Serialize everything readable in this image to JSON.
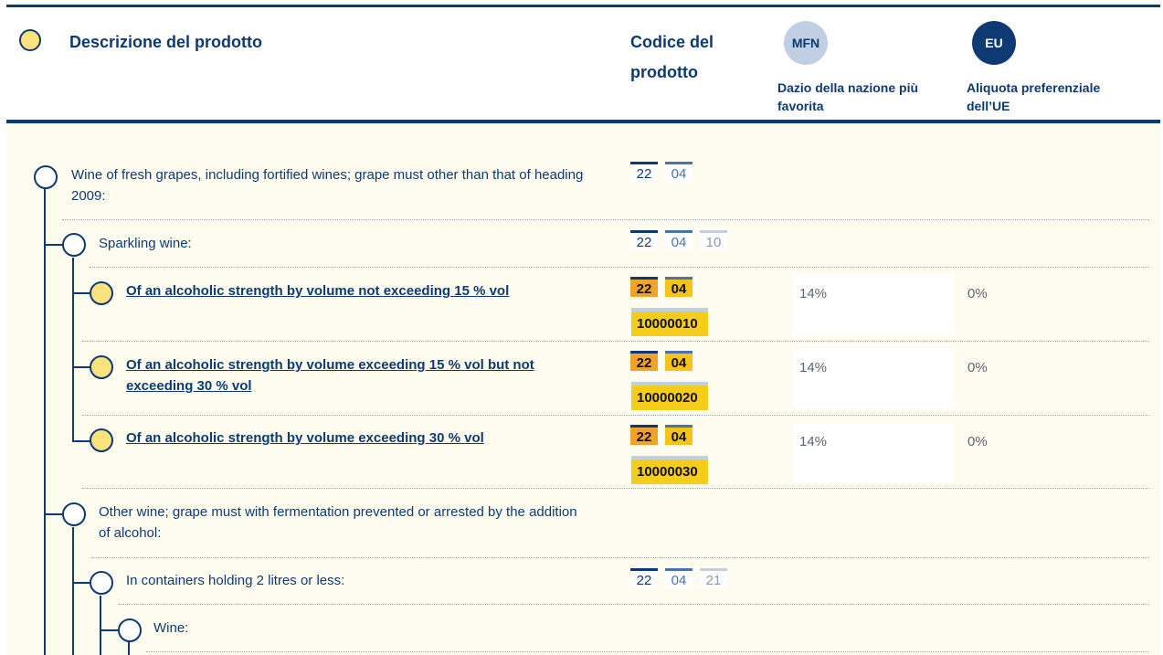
{
  "header": {
    "description_label": "Descrizione del prodotto",
    "code_label": "Codice del prodotto",
    "mfn_badge": "MFN",
    "mfn_label": "Dazio della nazione più favorita",
    "eu_badge": "EU",
    "eu_label": "Aliquota preferenziale dell’UE"
  },
  "rows": [
    {
      "text": "Wine of fresh grapes, including fortified wines; grape must other than that of heading 2009:",
      "code": [
        "22",
        "04"
      ]
    },
    {
      "text": "Sparkling wine:",
      "code": [
        "22",
        "04",
        "10"
      ]
    },
    {
      "text": "Of an alcoholic strength by volume not exceeding 15 % vol",
      "code": [
        "22",
        "04"
      ],
      "suffix": "10000010",
      "mfn": "14%",
      "eu": "0%"
    },
    {
      "text": "Of an alcoholic strength by volume exceeding 15 % vol but not exceeding 30 % vol",
      "code": [
        "22",
        "04"
      ],
      "suffix": "10000020",
      "mfn": "14%",
      "eu": "0%"
    },
    {
      "text": "Of an alcoholic strength by volume exceeding 30 % vol",
      "code": [
        "22",
        "04"
      ],
      "suffix": "10000030",
      "mfn": "14%",
      "eu": "0%"
    },
    {
      "text": "Other wine; grape must with fermentation prevented or arrested by the addition of alcohol:"
    },
    {
      "text": "In containers holding 2 litres or less:",
      "code": [
        "22",
        "04",
        "21"
      ]
    },
    {
      "text": "Wine:"
    }
  ],
  "colors": {
    "navy": "#0e3a73",
    "mid_blue": "#4a72ad",
    "light_blue": "#c1cfe4",
    "highlight_orange": "#f0a32a",
    "highlight_yellow": "#f6c31b",
    "circle_yellow": "#fbe27c",
    "content_bg": "#fefcee"
  }
}
